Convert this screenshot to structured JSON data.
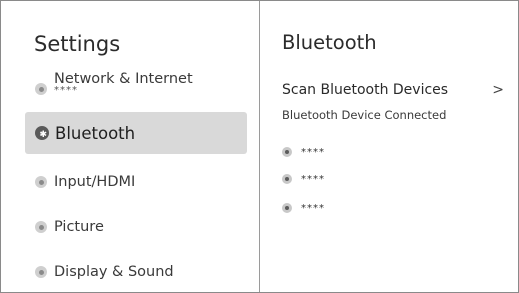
{
  "sidebar": {
    "title": "Settings",
    "items": [
      {
        "label": "Network & Internet",
        "sublabel": "****"
      },
      {
        "label": "Bluetooth",
        "icon": "bluetooth-icon"
      },
      {
        "label": "Input/HDMI"
      },
      {
        "label": "Picture"
      },
      {
        "label": "Display & Sound"
      }
    ]
  },
  "main": {
    "title": "Bluetooth",
    "scan_label": "Scan Bluetooth Devices",
    "chevron": ">",
    "connected_label": "Bluetooth Device Connected",
    "devices": [
      {
        "name": "****"
      },
      {
        "name": "****"
      },
      {
        "name": "****"
      }
    ]
  },
  "colors": {
    "selected_bg": "#d9d9d9",
    "divider": "#9a9a9a"
  }
}
